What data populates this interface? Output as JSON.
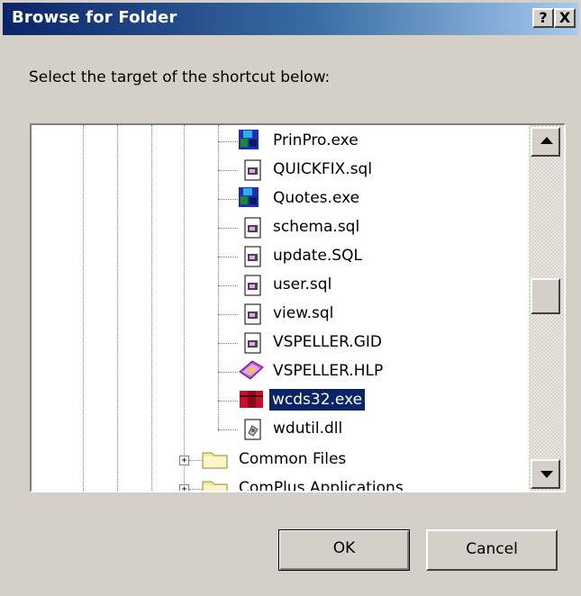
{
  "window": {
    "title": "Browse for Folder",
    "help_label": "?",
    "close_label": "X"
  },
  "prompt": "Select the target of the shortcut below:",
  "tree": {
    "items": [
      {
        "label": "PrinPro.exe",
        "icon": "app-exe-icon",
        "selected": false
      },
      {
        "label": "QUICKFIX.sql",
        "icon": "sql-file-icon",
        "selected": false
      },
      {
        "label": "Quotes.exe",
        "icon": "app-exe-icon",
        "selected": false
      },
      {
        "label": "schema.sql",
        "icon": "sql-file-icon",
        "selected": false
      },
      {
        "label": "update.SQL",
        "icon": "sql-file-icon",
        "selected": false
      },
      {
        "label": "user.sql",
        "icon": "sql-file-icon",
        "selected": false
      },
      {
        "label": "view.sql",
        "icon": "sql-file-icon",
        "selected": false
      },
      {
        "label": "VSPELLER.GID",
        "icon": "sql-file-icon",
        "selected": false
      },
      {
        "label": "VSPELLER.HLP",
        "icon": "help-book-icon",
        "selected": false
      },
      {
        "label": "wcds32.exe",
        "icon": "wcds-app-icon",
        "selected": true
      },
      {
        "label": "wdutil.dll",
        "icon": "dll-file-icon",
        "selected": false
      },
      {
        "label": "Common Files",
        "icon": "folder-icon",
        "selected": false
      },
      {
        "label": "ComPlus Applications",
        "icon": "folder-icon",
        "selected": false
      }
    ],
    "expander_symbol": "+"
  },
  "buttons": {
    "ok_label": "OK",
    "cancel_label": "Cancel"
  },
  "colors": {
    "titlebar_start": "#0a246a",
    "titlebar_end": "#a6caf0",
    "selection": "#0a246a",
    "face": "#d4d0c8"
  }
}
